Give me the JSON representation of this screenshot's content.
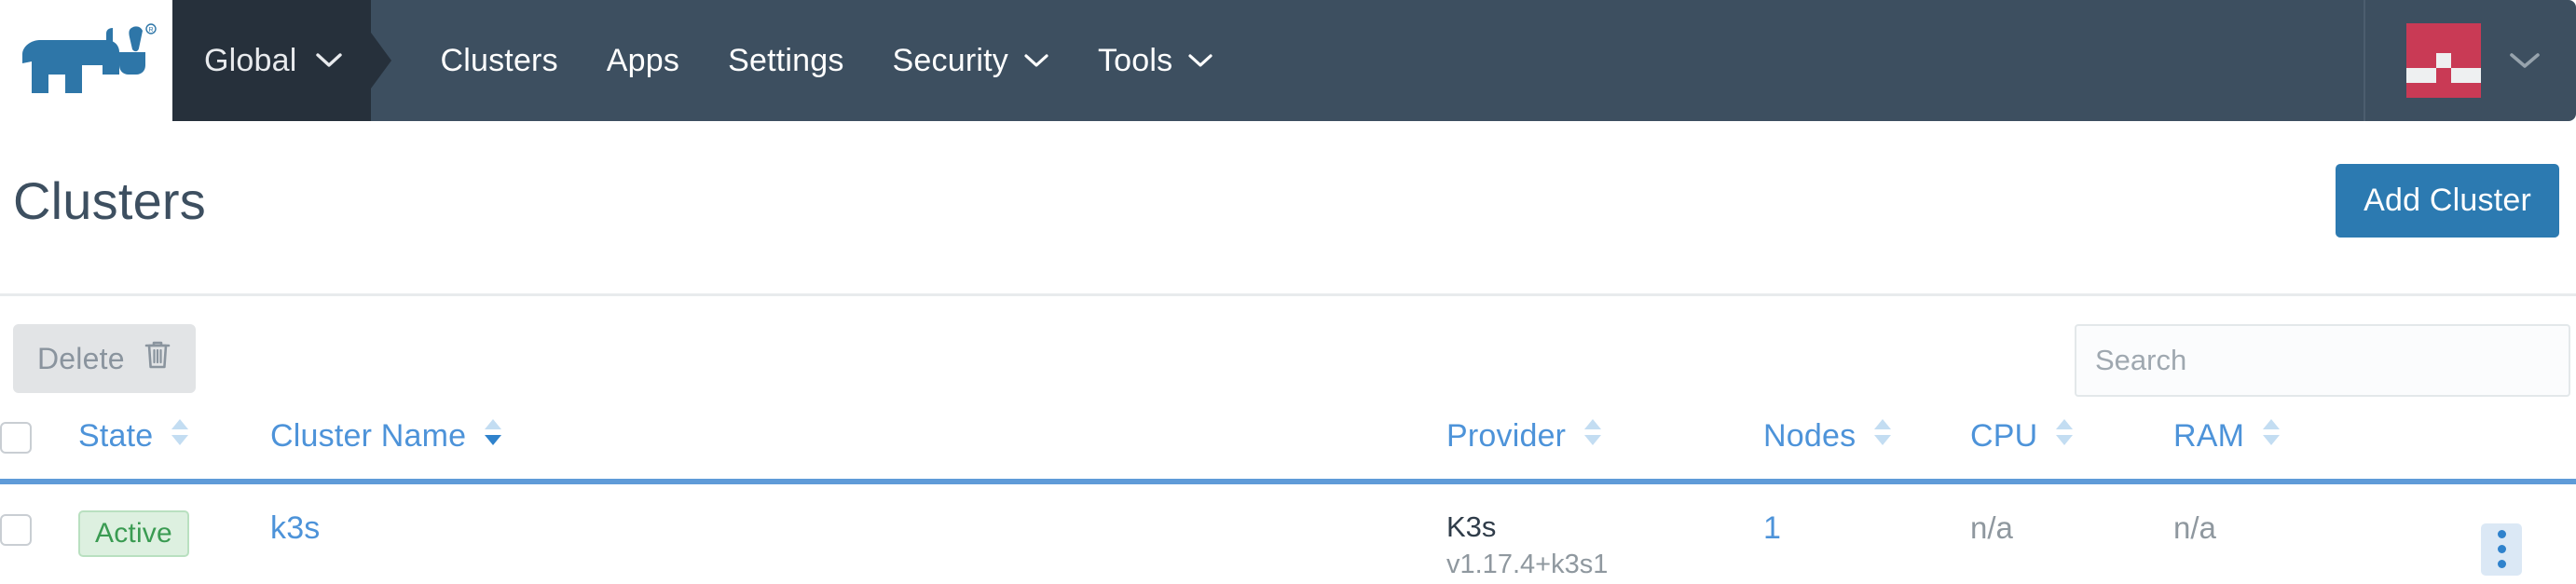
{
  "brand": {
    "logo_icon": "rancher-bull-logo",
    "logo_alt": "Rancher",
    "accent_blue": "#2c7ab1",
    "nav_bg": "#3d4f60",
    "nav_active_bg": "#26303b",
    "link_blue": "#4d93d9",
    "active_green": "#3a9b52",
    "avatar_red": "#c93a55"
  },
  "topnav": {
    "scope_label": "Global",
    "scope_icon": "chevron-down-icon",
    "items": [
      {
        "label": "Clusters",
        "has_dropdown": false,
        "icon": ""
      },
      {
        "label": "Apps",
        "has_dropdown": false,
        "icon": ""
      },
      {
        "label": "Settings",
        "has_dropdown": false,
        "icon": ""
      },
      {
        "label": "Security",
        "has_dropdown": true,
        "icon": "chevron-down-icon"
      },
      {
        "label": "Tools",
        "has_dropdown": true,
        "icon": "chevron-down-icon"
      }
    ],
    "user": {
      "avatar_icon": "user-identicon-avatar",
      "menu_icon": "chevron-down-icon"
    }
  },
  "page": {
    "title": "Clusters",
    "add_button_label": "Add Cluster"
  },
  "toolbar": {
    "delete_label": "Delete",
    "delete_icon": "trash-icon",
    "delete_disabled": true,
    "search_placeholder": "Search",
    "search_value": ""
  },
  "table": {
    "select_all_icon": "checkbox-icon",
    "columns": [
      {
        "key": "state",
        "label": "State",
        "sort_icon": "sort-both-icon",
        "sorted": false
      },
      {
        "key": "name",
        "label": "Cluster Name",
        "sort_icon": "sort-asc-icon",
        "sorted": true
      },
      {
        "key": "provider",
        "label": "Provider",
        "sort_icon": "sort-both-icon",
        "sorted": false
      },
      {
        "key": "nodes",
        "label": "Nodes",
        "sort_icon": "sort-both-icon",
        "sorted": false
      },
      {
        "key": "cpu",
        "label": "CPU",
        "sort_icon": "sort-both-icon",
        "sorted": false
      },
      {
        "key": "ram",
        "label": "RAM",
        "sort_icon": "sort-both-icon",
        "sorted": false
      }
    ],
    "rows": [
      {
        "checked": false,
        "state": "Active",
        "name": "k3s",
        "provider": "K3s",
        "provider_version": "v1.17.4+k3s1",
        "nodes": "1",
        "cpu": "n/a",
        "ram": "n/a",
        "actions_icon": "kebab-menu-icon"
      }
    ]
  }
}
